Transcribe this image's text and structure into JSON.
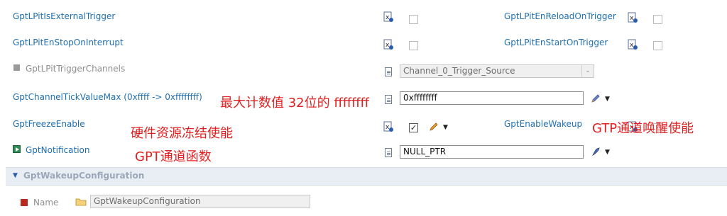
{
  "rows": {
    "external_trigger": {
      "label": "GptLPitIsExternalTrigger",
      "checked": false
    },
    "reload_on_trigger": {
      "label": "GptLPitEnReloadOnTrigger",
      "checked": false
    },
    "stop_on_interrupt": {
      "label": "GptLPitEnStopOnInterrupt",
      "checked": false
    },
    "start_on_trigger": {
      "label": "GptLPitEnStartOnTrigger",
      "checked": false
    },
    "trigger_channels": {
      "label": "GptLPitTriggerChannels",
      "value": "Channel_0_Trigger_Source"
    },
    "tick_value_max": {
      "label": "GptChannelTickValueMax (0xffff -> 0xffffffff)",
      "value": "0xffffffff"
    },
    "freeze_enable": {
      "label": "GptFreezeEnable",
      "checked": true
    },
    "enable_wakeup": {
      "label": "GptEnableWakeup"
    },
    "notification": {
      "label": "GptNotification",
      "value": "NULL_PTR"
    }
  },
  "section": {
    "title": "GptWakeupConfiguration"
  },
  "name_row": {
    "label": "Name",
    "value": "GptWakeupConfiguration"
  },
  "annotations": {
    "tick_max": "最大计数值 32位的 ffffffff",
    "freeze": "硬件资源冻结使能",
    "notification": "GPT通道函数",
    "wakeup": "GTP通道唤醒使能"
  },
  "icons": {
    "variant": "variant-icon",
    "doc": "document-icon",
    "edit": "pencil-icon",
    "menu": "dropdown-arrow-icon",
    "folder": "folder-icon"
  },
  "colors": {
    "label": "#1f6fb0",
    "annotation": "#e02020",
    "section": "#e9eef5"
  }
}
